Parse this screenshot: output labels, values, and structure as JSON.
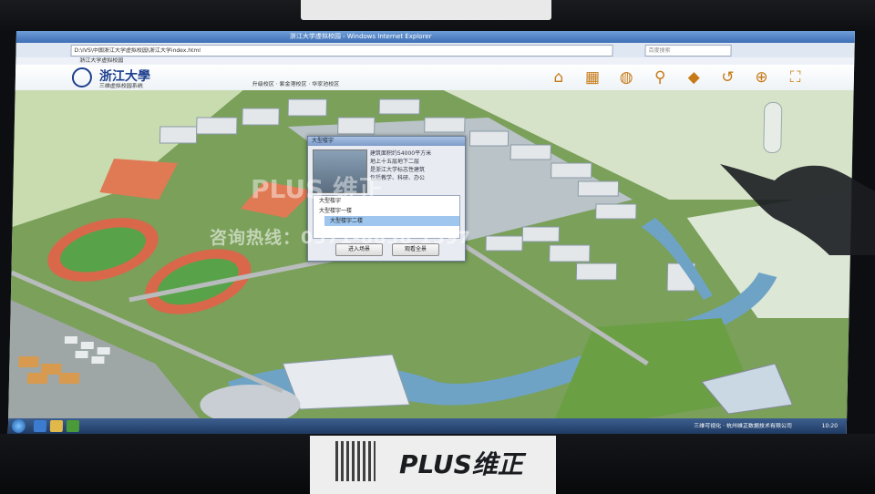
{
  "browser": {
    "window_title": "浙江大学虚拟校园 - Windows Internet Explorer",
    "address_url": "D:\\IVS\\中国浙江大学虚拟校园\\浙江大学index.html",
    "search_placeholder": "百度搜索",
    "tab_label": "浙江大学虚拟校园"
  },
  "app": {
    "logo_text": "浙江大學",
    "subtitle": "三维虚拟校园系统",
    "menu_text": "升级校区 · 紫金港校区 · 华家池校区",
    "toolbar_icons": [
      "home-icon",
      "building-icon",
      "globe-icon",
      "search-icon",
      "tag-icon",
      "undo-icon",
      "crosshair-icon",
      "fullscreen-icon"
    ]
  },
  "dialog": {
    "title": "大型楼宇",
    "info_lines": [
      "建筑面积约54000平方米",
      "地上十五层地下二层",
      "是浙江大学标志性建筑",
      "包括教学、科研、办公"
    ],
    "tree_items": [
      "大型楼宇",
      "大型楼宇一楼",
      "大型楼宇二楼"
    ],
    "button_enter": "进入场景",
    "button_full": "观看全景"
  },
  "overlay": {
    "brand_watermark": "PLUS 维正",
    "hotline": "咨询热线：0571-8838 1597"
  },
  "taskbar": {
    "company": "三维可视化 · 杭州维正数据技术有限公司",
    "clock": "10:20"
  },
  "stand": {
    "brand": "PLUS维正"
  },
  "colors": {
    "grass": "#6f9f4c",
    "track": "#d9684a",
    "river": "#6fa3c6",
    "brand_blue": "#1d3f8c",
    "taskbar": "#2b4a78"
  }
}
